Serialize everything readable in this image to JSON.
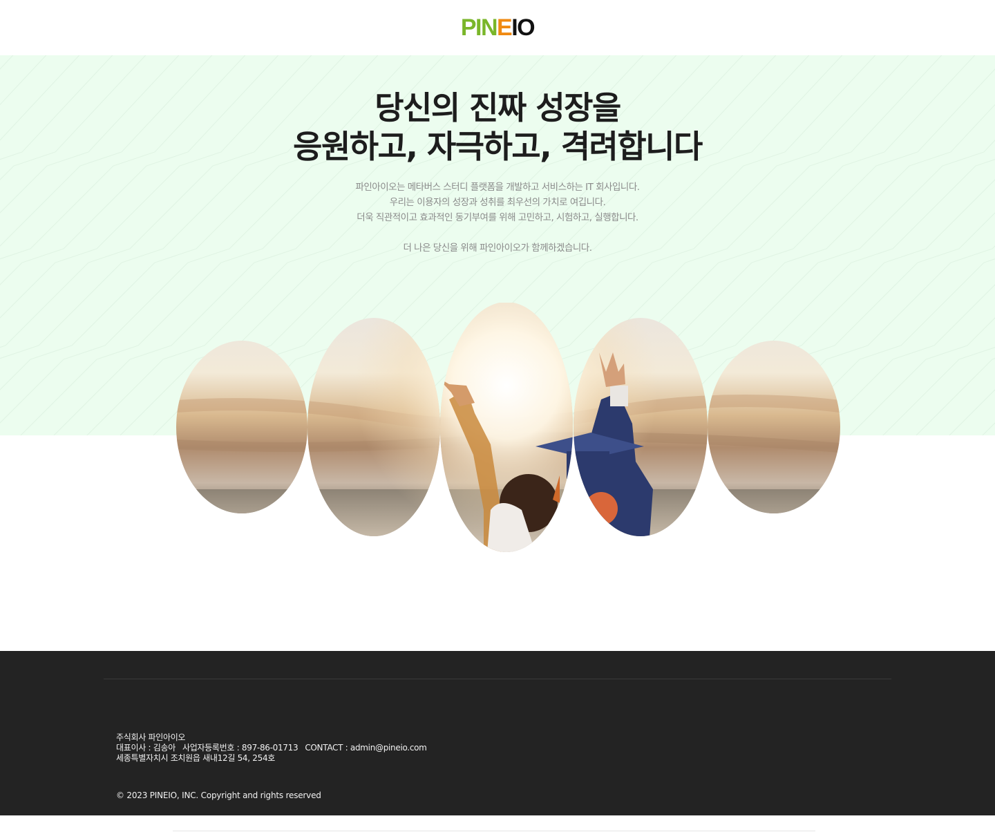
{
  "header": {
    "logo_part1": "PIN",
    "logo_part2": "E",
    "logo_part3": "IO",
    "colors": {
      "green": "#7ab62a",
      "orange": "#f08a12",
      "dark": "#111111"
    }
  },
  "hero": {
    "background": "#ecfdef",
    "headline_line1": "당신의 진짜 성장을",
    "headline_line2": "응원하고, 자극하고, 격려합니다",
    "sub_line1": "파인아이오는 메타버스 스터디 플랫폼을 개발하고 서비스하는 IT 회사입니다.",
    "sub_line2": "우리는 이용자의 성장과 성취를 최우선의 가치로 여깁니다.",
    "sub_line3": "더욱 직관적이고 효과적인 동기부여를 위해 고민하고, 시험하고, 실행합니다.",
    "sub_line4": "더 나은 당신을 위해 파인아이오가 함께하겠습니다.",
    "photo_icon": "graduation-photo-icon"
  },
  "footer": {
    "company": "주식회사 파인아이오",
    "ceo": "대표이사 : 김송아",
    "business_no": "사업자등록번호 : 897-86-01713",
    "contact": "CONTACT : admin@pineio.com",
    "address": "세종특별자치시 조치원읍 새내12길 54, 254호",
    "copyright": "© 2023 PINEIO, INC. Copyright and rights reserved",
    "background": "#232323"
  }
}
